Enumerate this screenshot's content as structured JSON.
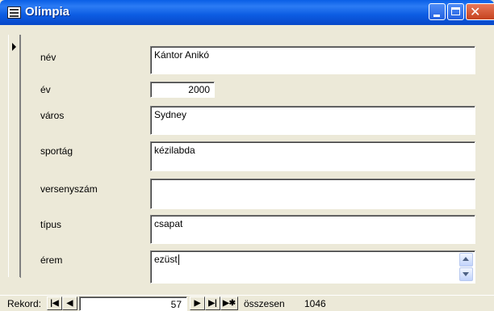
{
  "window": {
    "title": "Olimpia"
  },
  "fields": [
    {
      "label": "név",
      "value": "Kántor Anikó"
    },
    {
      "label": "év",
      "value": "2000"
    },
    {
      "label": "város",
      "value": "Sydney"
    },
    {
      "label": "sportág",
      "value": "kézilabda"
    },
    {
      "label": "versenyszám",
      "value": ""
    },
    {
      "label": "típus",
      "value": "csapat"
    },
    {
      "label": "érem",
      "value": "ezüst"
    }
  ],
  "navigation": {
    "label": "Rekord:",
    "current": "57",
    "total_label": "összesen",
    "total": "1046",
    "icons": [
      "first-record-icon",
      "previous-record-icon",
      "next-record-icon",
      "last-record-icon",
      "new-record-icon"
    ]
  }
}
